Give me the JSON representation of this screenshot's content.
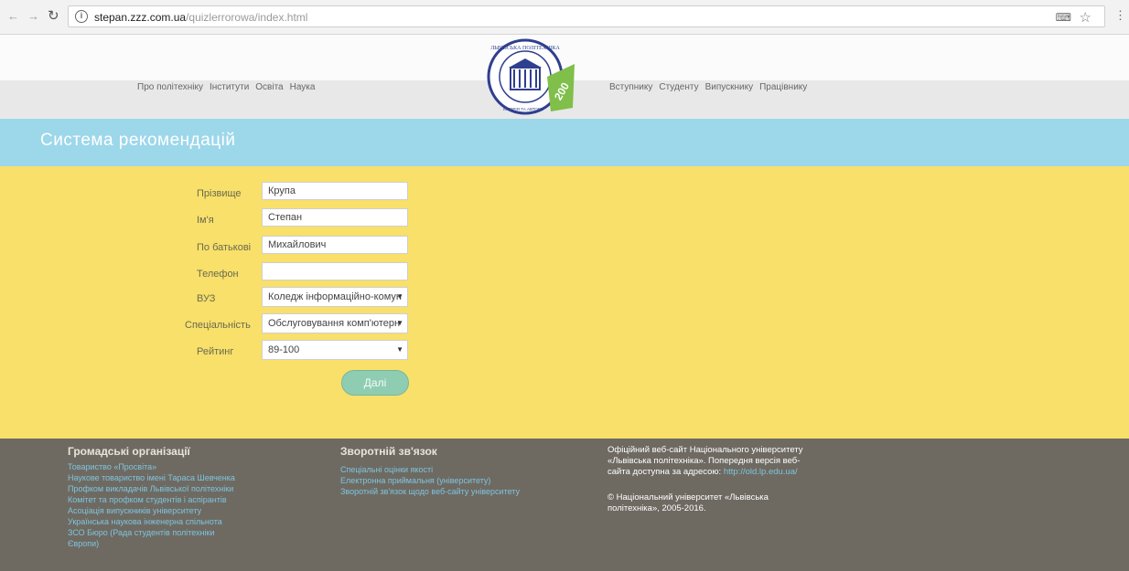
{
  "browser": {
    "url_host": "stepan.zzz.com.ua",
    "url_path": "/quizlerrorowa/index.html"
  },
  "nav": {
    "left": [
      "Про політехніку",
      "Інститути",
      "Освіта",
      "Наука"
    ],
    "right": [
      "Вступнику",
      "Студенту",
      "Випускнику",
      "Працівнику"
    ]
  },
  "page": {
    "title": "Система рекомендацій"
  },
  "form": {
    "fields": [
      {
        "label": "Прізвище",
        "value": "Крупа"
      },
      {
        "label": "Ім'я",
        "value": "Степан"
      },
      {
        "label": "По батькові",
        "value": "Михайлович"
      },
      {
        "label": "Телефон",
        "value": ""
      }
    ],
    "selects": [
      {
        "label": "ВУЗ",
        "value": "Коледж інформаційно-комун"
      },
      {
        "label": "Спеціальність",
        "value": "Обслуговування комп'ютерн"
      },
      {
        "label": "Рейтинг",
        "value": "89-100"
      }
    ],
    "submit_label": "Далі"
  },
  "footer": {
    "col1": {
      "title": "Громадські організації",
      "links": [
        "Товариство «Просвіта»",
        "Наукове товариство імені Тараса Шевченка",
        "Профком викладачів Львівської політехніки",
        "Комітет та профком студентів і аспірантів",
        "Асоціація випускників університету",
        "Українська наукова інженерна спільнота",
        "ЗСО Бюро (Рада студентів політехніки",
        "Європи)"
      ]
    },
    "col2": {
      "title": "Зворотній зв'язок",
      "links": [
        "Спеціальні оцінки якості",
        "Електронна приймальня (університету)",
        "Зворотній зв'язок щодо веб-сайту університету"
      ]
    },
    "col3": {
      "line1": "Офіційний веб-сайт Національного університету",
      "line2": "«Львівська політехніка». Попередня версія веб-",
      "line3": "сайта доступна за адресою:",
      "old_url": "http://old.lp.edu.ua/",
      "copyright1": "© Національний університет «Львівська",
      "copyright2": "політехніка», 2005-2016."
    }
  },
  "logo": {
    "text_top": "ЛЬВІВСЬКА ПОЛІТЕХНІКА",
    "text_bottom": "ІСТОРІЯ ТА АВТОРИ",
    "badge": "200"
  }
}
